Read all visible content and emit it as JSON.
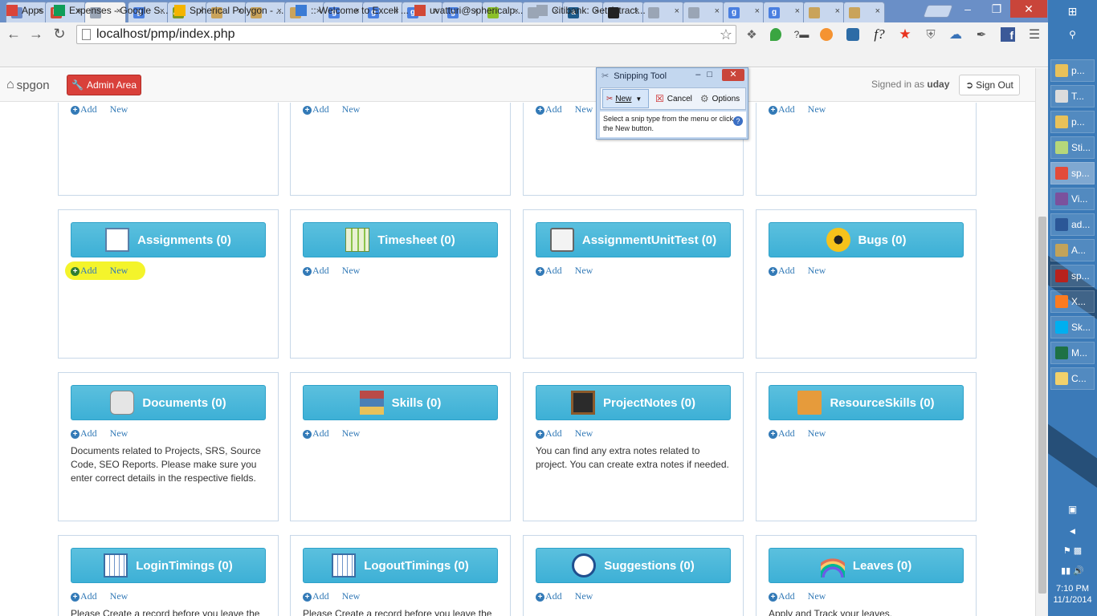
{
  "browser": {
    "tabs": [
      {
        "icon": "generic-icon",
        "color": "#6b88c4"
      },
      {
        "icon": "gmail-icon",
        "color": "#d14836",
        "glyph": "M"
      },
      {
        "icon": "page-icon",
        "color": "#9aa5b5",
        "active": true
      },
      {
        "icon": "google-icon",
        "color": "#4a7fe0",
        "glyph": "g"
      },
      {
        "icon": "as-icon",
        "color": "#7f9a1f",
        "glyph": "As"
      },
      {
        "icon": "stack-icon",
        "color": "#c9a35b"
      },
      {
        "icon": "stack-icon",
        "color": "#c9a35b"
      },
      {
        "icon": "stack-icon",
        "color": "#c9a35b"
      },
      {
        "icon": "google-icon",
        "color": "#4a7fe0",
        "glyph": "g"
      },
      {
        "icon": "google-icon",
        "color": "#4a7fe0",
        "glyph": "g"
      },
      {
        "icon": "google-icon",
        "color": "#4a7fe0",
        "glyph": "g"
      },
      {
        "icon": "google-icon",
        "color": "#4a7fe0",
        "glyph": "g"
      },
      {
        "icon": "bolt-icon",
        "color": "#8bbf2a"
      },
      {
        "icon": "page-icon",
        "color": "#9aa5b5"
      },
      {
        "icon": "a-icon",
        "color": "#1d5a8a",
        "glyph": "a"
      },
      {
        "icon": "github-icon",
        "color": "#222222"
      },
      {
        "icon": "page-icon",
        "color": "#9aa5b5"
      },
      {
        "icon": "page-icon",
        "color": "#9aa5b5"
      },
      {
        "icon": "google-icon",
        "color": "#4a7fe0",
        "glyph": "g"
      },
      {
        "icon": "google-icon",
        "color": "#4a7fe0",
        "glyph": "g"
      },
      {
        "icon": "stack-icon",
        "color": "#c9a35b"
      },
      {
        "icon": "stack-icon",
        "color": "#c9a35b"
      }
    ],
    "url": "localhost/pmp/index.php",
    "bookmarks": [
      {
        "label": "Apps",
        "color": "#d9443a"
      },
      {
        "label": "Expenses - Google S...",
        "color": "#0f9d58"
      },
      {
        "label": "Spherical Polygon - ...",
        "color": "#f4b400"
      },
      {
        "label": ":: Welcome to Excell ...",
        "color": "#3a7bd5"
      },
      {
        "label": "uvatturi@sphericalp...",
        "color": "#d14836"
      },
      {
        "label": "Citibank: Get Attract...",
        "color": "#9aa5b5"
      }
    ]
  },
  "app": {
    "brand": "spgon",
    "admin_label": "Admin Area",
    "signed_in_prefix": "Signed in as",
    "user": "uday",
    "signout_label": "Sign Out",
    "accent": "#5bc0de",
    "danger": "#d9403a"
  },
  "cards": [
    {
      "title": "",
      "add": "Add",
      "new": "New",
      "desc": ""
    },
    {
      "title": "",
      "add": "Add",
      "new": "New",
      "desc": ""
    },
    {
      "title": "",
      "add": "Add",
      "new": "New",
      "desc": ""
    },
    {
      "title": "",
      "add": "Add",
      "new": "New",
      "desc": ""
    },
    {
      "title": "Assignments (0)",
      "icon": "list-icon",
      "add": "Add",
      "new": "New",
      "desc": "",
      "highlight": true
    },
    {
      "title": "Timesheet (0)",
      "icon": "timesheet-icon",
      "add": "Add",
      "new": "New",
      "desc": ""
    },
    {
      "title": "AssignmentUnitTest (0)",
      "icon": "clipboard-icon",
      "add": "Add",
      "new": "New",
      "desc": ""
    },
    {
      "title": "Bugs (0)",
      "icon": "radiation-icon",
      "add": "Add",
      "new": "New",
      "desc": ""
    },
    {
      "title": "Documents (0)",
      "icon": "documents-icon",
      "add": "Add",
      "new": "New",
      "desc": "Documents related to Projects, SRS, Source Code, SEO Reports. Please make sure you enter correct details in the respective fields."
    },
    {
      "title": "Skills (0)",
      "icon": "books-icon",
      "add": "Add",
      "new": "New",
      "desc": ""
    },
    {
      "title": "ProjectNotes (0)",
      "icon": "chalkboard-icon",
      "add": "Add",
      "new": "New",
      "desc": "You can find any extra notes related to project. You can create extra notes if needed."
    },
    {
      "title": "ResourceSkills (0)",
      "icon": "address-book-icon",
      "add": "Add",
      "new": "New",
      "desc": ""
    },
    {
      "title": "LoginTimings (0)",
      "icon": "calendar-icon",
      "add": "Add",
      "new": "New",
      "desc": "Please Create a record before you leave the"
    },
    {
      "title": "LogoutTimings (0)",
      "icon": "calendar-icon",
      "add": "Add",
      "new": "New",
      "desc": "Please Create a record before you leave the"
    },
    {
      "title": "Suggestions (0)",
      "icon": "info-icon",
      "add": "Add",
      "new": "New",
      "desc": ""
    },
    {
      "title": "Leaves (0)",
      "icon": "rainbow-icon",
      "add": "Add",
      "new": "New",
      "desc": "Apply and Track your leaves."
    }
  ],
  "snipping_tool": {
    "title": "Snipping Tool",
    "new_label": "New",
    "cancel_label": "Cancel",
    "options_label": "Options",
    "message": "Select a snip type from the menu or click the New button."
  },
  "taskbar": {
    "items": [
      {
        "label": "p...",
        "color": "#e8c15a"
      },
      {
        "label": "T...",
        "color": "#dcdcdc"
      },
      {
        "label": "p...",
        "color": "#e8c15a"
      },
      {
        "label": "Sti...",
        "color": "#b6d77a"
      },
      {
        "label": "sp...",
        "color": "#e34b3a"
      },
      {
        "label": "Vi...",
        "color": "#7b519d"
      },
      {
        "label": "ad...",
        "color": "#2b5797"
      },
      {
        "label": "A...",
        "color": "#c2a35a"
      },
      {
        "label": "sp...",
        "color": "#b8221d"
      },
      {
        "label": "X...",
        "color": "#fb7b20"
      },
      {
        "label": "Sk...",
        "color": "#00aff0"
      },
      {
        "label": "M...",
        "color": "#1e7145"
      },
      {
        "label": "C...",
        "color": "#f2d16b"
      }
    ],
    "time": "7:10 PM",
    "date": "11/1/2014"
  }
}
